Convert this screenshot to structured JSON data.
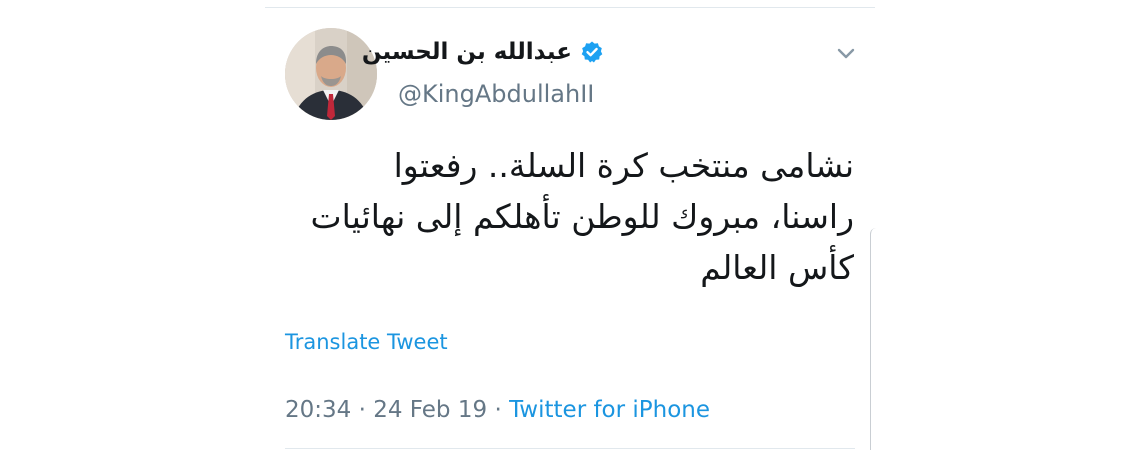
{
  "tweet": {
    "display_name": "عبدالله بن الحسين",
    "handle": "@KingAbdullahII",
    "verified_icon": "verified-badge-icon",
    "menu_icon": "chevron-down-icon",
    "text_lines": [
      "نشامى منتخب كرة السلة.. رفعتوا",
      "راسنا، مبروك للوطن تأهلكم إلى نهائيات",
      "كأس العالم"
    ],
    "translate_label": "Translate Tweet",
    "time": "20:34",
    "date": "24 Feb 19",
    "separator": "·",
    "source": "Twitter for iPhone"
  },
  "colors": {
    "link": "#1b95e0",
    "secondary_text": "#657786",
    "primary_text": "#14171a",
    "border": "#e1e8ed"
  }
}
